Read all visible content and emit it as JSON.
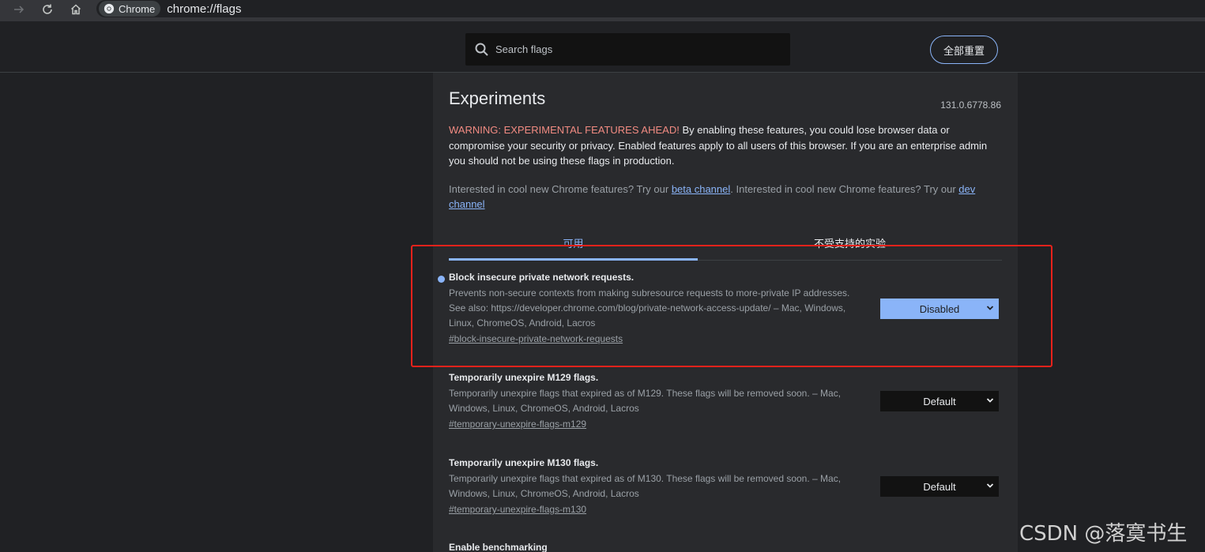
{
  "browser": {
    "chip_label": "Chrome",
    "url": "chrome://flags"
  },
  "header": {
    "search_placeholder": "Search flags",
    "reset_all_label": "全部重置"
  },
  "page": {
    "title": "Experiments",
    "version": "131.0.6778.86",
    "warning_prefix": "WARNING: EXPERIMENTAL FEATURES AHEAD!",
    "warning_text": " By enabling these features, you could lose browser data or compromise your security or privacy. Enabled features apply to all users of this browser. If you are an enterprise admin you should not be using these flags in production.",
    "interest_text_1": "Interested in cool new Chrome features? Try our ",
    "beta_link": "beta channel",
    "interest_text_2": ". Interested in cool new Chrome features? Try our ",
    "dev_link": "dev channel"
  },
  "tabs": {
    "available": "可用",
    "unavailable": "不受支持的实验"
  },
  "flags": [
    {
      "name": "Block insecure private network requests.",
      "description": "Prevents non-secure contexts from making subresource requests to more-private IP addresses. See also: https://developer.chrome.com/blog/private-network-access-update/ – Mac, Windows, Linux, ChromeOS, Android, Lacros",
      "link": "#block-insecure-private-network-requests",
      "value": "Disabled"
    },
    {
      "name": "Temporarily unexpire M129 flags.",
      "description": "Temporarily unexpire flags that expired as of M129. These flags will be removed soon. – Mac, Windows, Linux, ChromeOS, Android, Lacros",
      "link": "#temporary-unexpire-flags-m129",
      "value": "Default"
    },
    {
      "name": "Temporarily unexpire M130 flags.",
      "description": "Temporarily unexpire flags that expired as of M130. These flags will be removed soon. – Mac, Windows, Linux, ChromeOS, Android, Lacros",
      "link": "#temporary-unexpire-flags-m130",
      "value": "Default"
    },
    {
      "name": "Enable benchmarking"
    }
  ],
  "watermark": "CSDN @落寞书生",
  "colors": {
    "accent": "#8ab4f8",
    "warning": "#f28b82",
    "highlight_box": "#e8221b"
  }
}
